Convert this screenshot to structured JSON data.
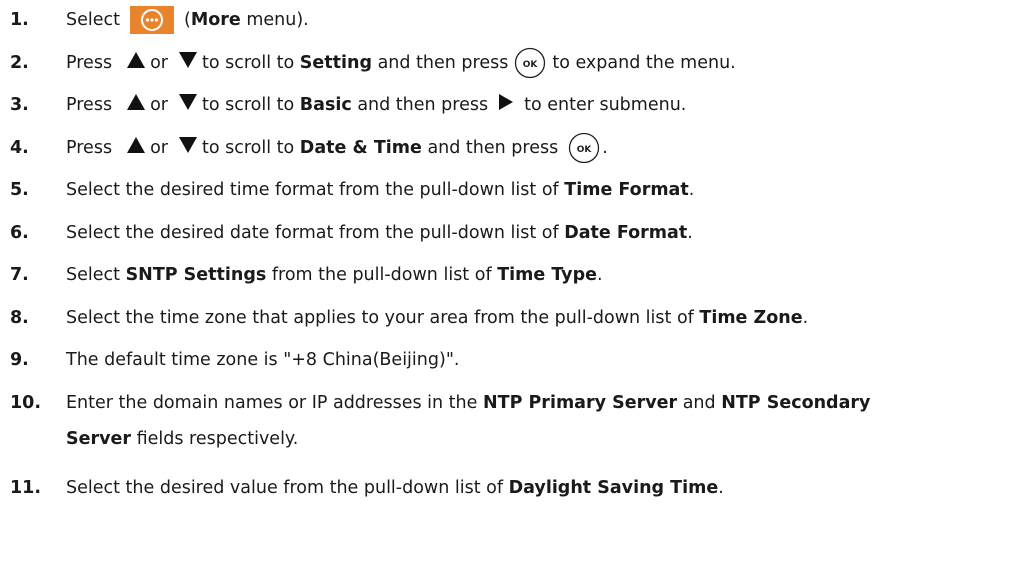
{
  "steps": [
    {
      "num": "1.",
      "a": "Select",
      "b": "(",
      "c": "More",
      "d": " menu)."
    },
    {
      "num": "2.",
      "a": "Press",
      "or": "or",
      "b": "to scroll to",
      "c": "Setting",
      "d": "and then press",
      "e": "to expand the menu."
    },
    {
      "num": "3.",
      "a": "Press",
      "or": "or",
      "b": "to scroll to",
      "c": "Basic",
      "d": "and then press",
      "e": "to enter submenu."
    },
    {
      "num": "4.",
      "a": "Press",
      "or": "or",
      "b": "to scroll to",
      "c": "Date & Time",
      "d": "and then press",
      "e": "."
    },
    {
      "num": "5.",
      "a": "Select the desired time format from the pull-down list of",
      "c": "Time Format",
      "d": "."
    },
    {
      "num": "6.",
      "a": "Select the desired date format from the pull-down list of",
      "c": "Date Format",
      "d": "."
    },
    {
      "num": "7.",
      "a": "Select",
      "c": "SNTP Settings",
      "b": "from the pull-down list of",
      "e": "Time Type",
      "d": "."
    },
    {
      "num": "8.",
      "a": "Select the time zone that applies to your area from the pull-down list of",
      "c": "Time Zone",
      "d": "."
    },
    {
      "num": "9.",
      "a": "The default time zone is \"+8 China(Beijing)\"."
    },
    {
      "num": "10.",
      "a": "Enter the domain names or IP addresses in the",
      "c": "NTP Primary Server",
      "b": "and",
      "e": "NTP Secondary",
      "f": "Server",
      "d": "fields respectively."
    },
    {
      "num": "11.",
      "a": "Select the desired value from the pull-down list of",
      "c": "Daylight Saving Time",
      "d": "."
    }
  ],
  "icons": {
    "more": "more-menu-icon",
    "ok": "ok-key-icon",
    "up": "up-arrow-icon",
    "down": "down-arrow-icon",
    "right": "right-arrow-icon",
    "more_color": "#e8842c"
  },
  "ok_label": "OK"
}
